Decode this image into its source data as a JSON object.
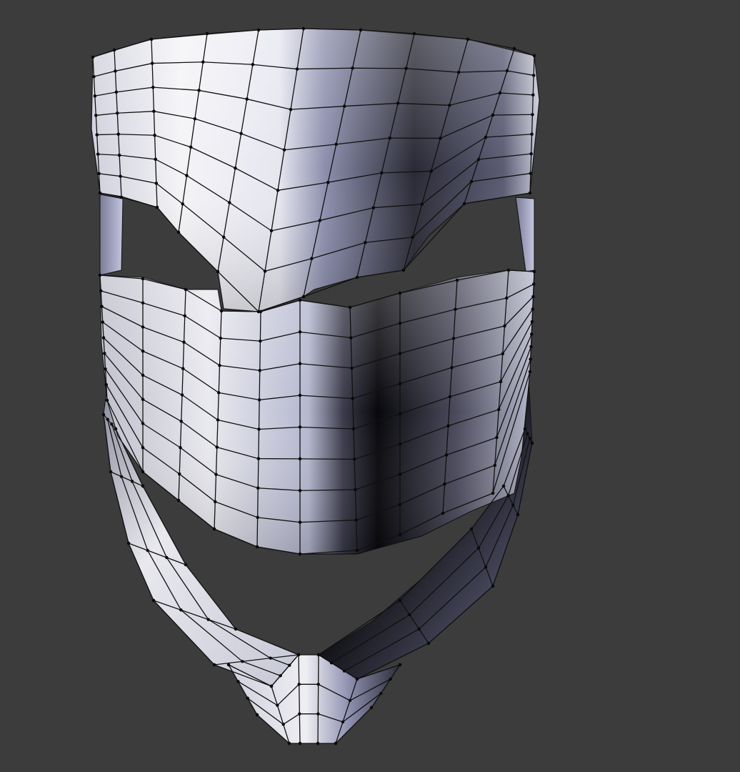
{
  "viewport": {
    "background_color": "#3c3c3c",
    "object": "mask-mesh",
    "view_mode": "edit-mode-wireframe-over-solid",
    "colors": {
      "surface_light": "#f2f2f6",
      "surface_mid": "#a9abc9",
      "surface_dark": "#0c0c12",
      "wire": "#111111"
    }
  }
}
